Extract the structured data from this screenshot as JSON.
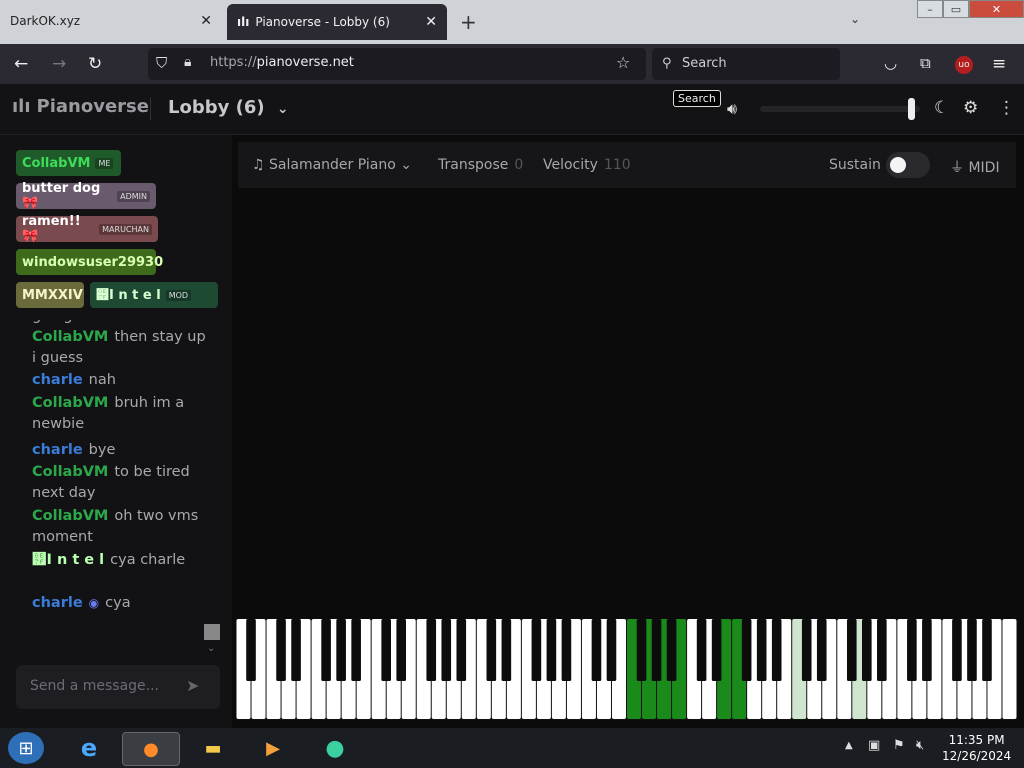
{
  "browser": {
    "tabs": [
      {
        "title": "DarkOK.xyz",
        "active": false
      },
      {
        "title": "Pianoverse - Lobby (6)",
        "active": true
      }
    ],
    "url_prefix": "https://",
    "url_host": "pianoverse.net",
    "search_placeholder": "Search",
    "tooltip": "Search"
  },
  "app": {
    "brand": "Pianoverse",
    "room": "Lobby (6)",
    "users": [
      {
        "name": "CollabVM",
        "badge": "ME",
        "bg": "#1f5a2a",
        "color": "#3fdc5a"
      },
      {
        "name": "butter dog🎀",
        "badge": "ADMIN",
        "bg": "#6a5a6e",
        "color": "#ffffff"
      },
      {
        "name": "ramen!!🎀",
        "badge": "MARUCHAN",
        "bg": "#7a4a4e",
        "color": "#ffffff"
      },
      {
        "name": "windowsuser29930",
        "badge": "",
        "bg": "#3e6a1c",
        "color": "#d8ffb0"
      },
      {
        "name": "MMXXIV",
        "badge": "",
        "bg": "#6a6a3a",
        "color": "#f5f5cc"
      },
      {
        "name": "୿I n t e l",
        "badge": "MOD",
        "bg": "#1e4a34",
        "color": "#d8ffd0"
      }
    ],
    "chat": [
      {
        "name": "",
        "text": "going",
        "color": "#a8a8ae"
      },
      {
        "name": "CollabVM",
        "text": "then stay up i guess",
        "color": "#2ca84a"
      },
      {
        "name": "charle",
        "text": "nah",
        "color": "#3a7cd8"
      },
      {
        "name": "CollabVM",
        "text": "bruh im a newbie",
        "color": "#2ca84a"
      },
      {
        "name": "charle",
        "text": "bye",
        "color": "#3a7cd8"
      },
      {
        "name": "CollabVM",
        "text": "to be tired next day",
        "color": "#2ca84a"
      },
      {
        "name": "CollabVM",
        "text": "oh two vms moment",
        "color": "#2ca84a"
      },
      {
        "name": "୿I n t e l",
        "text": "cya charle",
        "color": "#b9ffb0"
      },
      {
        "name": "charle",
        "text": "cya",
        "color": "#3a7cd8"
      }
    ],
    "message_placeholder": "Send a message...",
    "controls": {
      "instrument": "Salamander Piano",
      "transpose_label": "Transpose",
      "transpose_value": "0",
      "velocity_label": "Velocity",
      "velocity_value": "110",
      "sustain_label": "Sustain",
      "midi_label": "MIDI"
    },
    "volume_level": 0.97,
    "pressed_white_keys": [
      26,
      27,
      28,
      29,
      32,
      33
    ],
    "faint_white_keys": [
      37,
      41
    ]
  },
  "taskbar": {
    "time": "11:35 PM",
    "date": "12/26/2024"
  }
}
